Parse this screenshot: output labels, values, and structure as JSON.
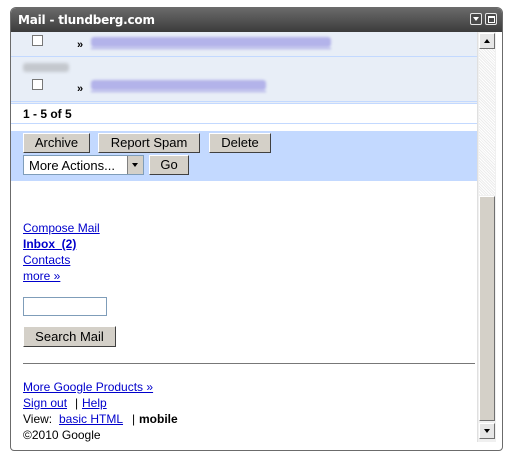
{
  "window": {
    "title": "Mail - tlundberg.com"
  },
  "mail_list": {
    "rows": [
      {
        "sender": "",
        "subject": ""
      },
      {
        "sender": "",
        "subject": ""
      }
    ],
    "arrow": "»",
    "paging": "1 - 5 of 5"
  },
  "actions": {
    "archive": "Archive",
    "report_spam": "Report Spam",
    "delete": "Delete",
    "more_actions": "More Actions...",
    "go": "Go"
  },
  "nav": {
    "compose": "Compose Mail",
    "inbox": "Inbox  (2)",
    "contacts": "Contacts",
    "more": "more »"
  },
  "search": {
    "value": "",
    "button": "Search Mail"
  },
  "footer": {
    "more_products": "More Google Products »",
    "sign_out": "Sign out",
    "separator": "|",
    "help": "Help",
    "view_label": "View:",
    "basic_html": "basic HTML",
    "mobile": "mobile",
    "copyright": "©2010 Google"
  },
  "colors": {
    "list_bg": "#e8eef7",
    "action_bar_bg": "#c3d9ff",
    "link": "#0000cc",
    "titlebar": "#4a4a4a"
  }
}
